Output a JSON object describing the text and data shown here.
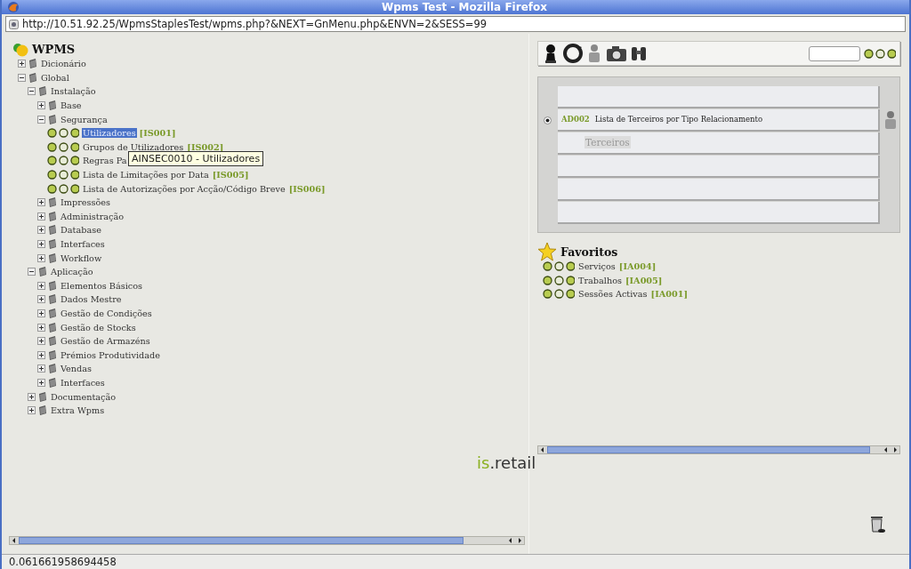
{
  "window": {
    "title": "Wpms Test - Mozilla Firefox"
  },
  "url": "http://10.51.92.25/WpmsStaplesTest/wpms.php?&NEXT=GnMenu.php&ENVN=2&SESS=99",
  "tree": {
    "title": "WPMS",
    "items": [
      {
        "kind": "folder",
        "label": "Dicionário",
        "expanded": false
      },
      {
        "kind": "folder",
        "label": "Global",
        "expanded": true,
        "children": [
          {
            "kind": "folder",
            "label": "Instalação",
            "expanded": true,
            "children": [
              {
                "kind": "folder",
                "label": "Base",
                "expanded": false
              },
              {
                "kind": "folder",
                "label": "Segurança",
                "expanded": true,
                "children": [
                  {
                    "kind": "leaf",
                    "label": "Utilizadores",
                    "code": "[IS001]",
                    "selected": true
                  },
                  {
                    "kind": "leaf",
                    "label": "Grupos de Utilizadores",
                    "code": "[IS002]",
                    "selected": false
                  },
                  {
                    "kind": "leaf",
                    "label": "Regras Pa",
                    "selected": false
                  },
                  {
                    "kind": "leaf",
                    "label": "Lista de Limitações por Data",
                    "code": "[IS005]",
                    "selected": false
                  },
                  {
                    "kind": "leaf",
                    "label": "Lista de Autorizações por Acção/Código Breve",
                    "code": "[IS006]",
                    "selected": false
                  }
                ]
              },
              {
                "kind": "folder",
                "label": "Impressões",
                "expanded": false
              },
              {
                "kind": "folder",
                "label": "Administração",
                "expanded": false
              },
              {
                "kind": "folder",
                "label": "Database",
                "expanded": false
              },
              {
                "kind": "folder",
                "label": "Interfaces",
                "expanded": false
              },
              {
                "kind": "folder",
                "label": "Workflow",
                "expanded": false
              }
            ]
          },
          {
            "kind": "folder",
            "label": "Aplicação",
            "expanded": true,
            "children": [
              {
                "kind": "folder",
                "label": "Elementos Básicos",
                "expanded": false
              },
              {
                "kind": "folder",
                "label": "Dados Mestre",
                "expanded": false
              },
              {
                "kind": "folder",
                "label": "Gestão de Condições",
                "expanded": false
              },
              {
                "kind": "folder",
                "label": "Gestão de Stocks",
                "expanded": false
              },
              {
                "kind": "folder",
                "label": "Gestão de Armazéns",
                "expanded": false
              },
              {
                "kind": "folder",
                "label": "Prémios Produtividade",
                "expanded": false
              },
              {
                "kind": "folder",
                "label": "Vendas",
                "expanded": false
              },
              {
                "kind": "folder",
                "label": "Interfaces",
                "expanded": false
              }
            ]
          },
          {
            "kind": "folder",
            "label": "Documentação",
            "expanded": false
          },
          {
            "kind": "folder",
            "label": "Extra Wpms",
            "expanded": false
          }
        ]
      }
    ]
  },
  "tooltip": "AINSEC0010 - Utilizadores",
  "logo": {
    "prefix": "is",
    "suffix": ".retail"
  },
  "panel_rows": [
    {
      "kind": "empty"
    },
    {
      "kind": "entry",
      "code": "AD002",
      "label": "Lista de Terceiros por Tipo Relacionamento",
      "selected": true
    },
    {
      "kind": "sub",
      "label": "Terceiros"
    },
    {
      "kind": "empty"
    },
    {
      "kind": "empty"
    },
    {
      "kind": "empty"
    }
  ],
  "favorites": {
    "title": "Favoritos",
    "items": [
      {
        "label": "Serviços",
        "code": "[IA004]"
      },
      {
        "label": "Trabalhos",
        "code": "[IA005]"
      },
      {
        "label": "Sessões Activas",
        "code": "[IA001]"
      }
    ]
  },
  "status_bar": "0.061661958694458"
}
